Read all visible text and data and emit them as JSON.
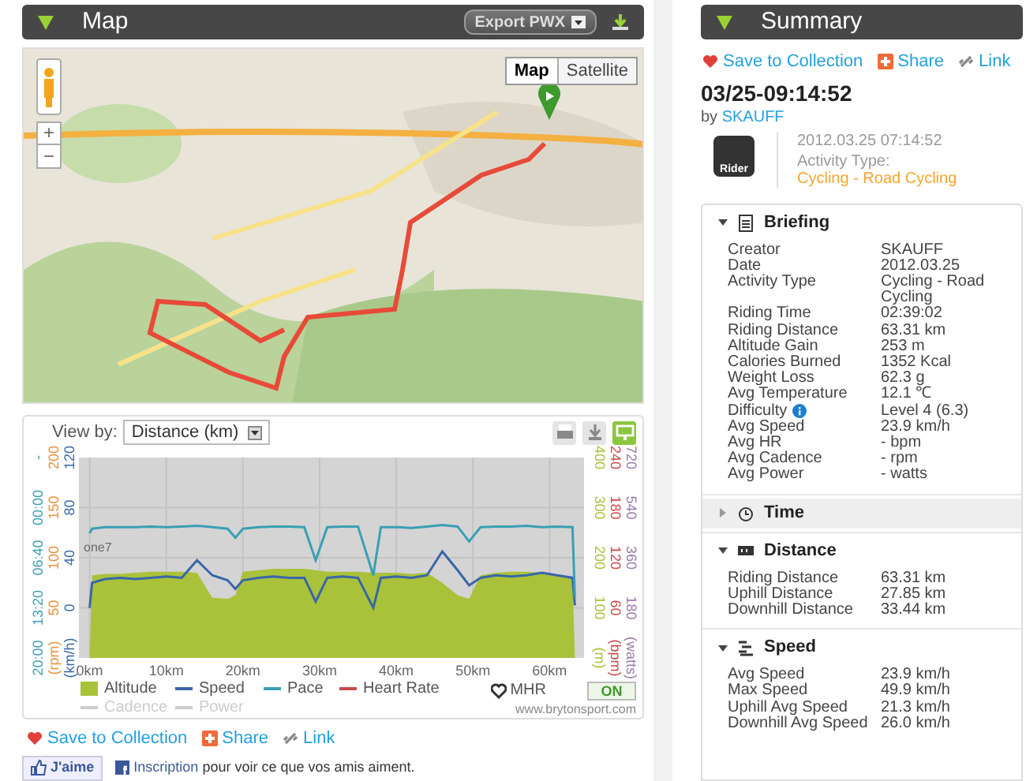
{
  "map_panel": {
    "title": "Map",
    "export_button": "Export PWX"
  },
  "map": {
    "kind": "picture",
    "map_types": [
      {
        "label": "Map",
        "selected": true
      },
      {
        "label": "Satellite",
        "selected": false
      }
    ],
    "zoom_in": "+",
    "zoom_out": "−"
  },
  "chart_panel": {
    "view_by_label": "View by:",
    "view_by_value": "Distance (km)",
    "tools": [
      {
        "kind": "print",
        "selected": false
      },
      {
        "kind": "download",
        "selected": false
      },
      {
        "kind": "screen",
        "selected": true
      }
    ],
    "left_axes": [
      {
        "color": "#e8913a",
        "ticks": [
          "(rpm)",
          "50",
          "100",
          "150",
          "200"
        ]
      }
    ],
    "right_axes": [
      {
        "color": "#c94a4a",
        "ticks": [
          "(bpm)",
          "60",
          "120",
          "180",
          "240"
        ]
      },
      {
        "color": "#9a7aa8",
        "ticks": [
          "(watts)",
          "180",
          "360",
          "540",
          "720"
        ]
      }
    ],
    "charts": [
      {
        "chart_data": {
          "type": "area",
          "x": [
            0,
            0.3,
            2,
            4,
            6,
            8,
            10,
            12,
            14,
            16,
            18,
            19,
            20,
            22,
            24,
            26,
            28,
            29.5,
            31,
            33,
            35,
            37,
            38,
            40,
            42,
            44,
            46,
            48,
            49.5,
            51,
            53,
            55,
            57,
            59,
            61,
            63,
            63.3
          ],
          "series": [
            {
              "name": "Altitude",
              "color": "#a9c23a",
              "values": [
                0,
                165,
                168,
                168,
                170,
                172,
                172,
                172,
                170,
                120,
                118,
                125,
                172,
                175,
                178,
                178,
                178,
                175,
                172,
                172,
                172,
                170,
                170,
                170,
                168,
                170,
                150,
                125,
                118,
                165,
                170,
                172,
                172,
                170,
                165,
                160,
                0
              ]
            }
          ],
          "xlim": [
            -1.4,
            64.5
          ],
          "ylim": [
            0,
            400
          ],
          "yticks": [
            {
              "value": 0,
              "label": "(m)"
            },
            100,
            200,
            300,
            400
          ]
        }
      },
      {
        "chart_data": {
          "type": "line",
          "x": [
            0,
            0.3,
            2,
            4,
            6,
            8,
            10,
            12,
            14,
            16,
            18,
            19,
            20,
            22,
            24,
            26,
            28,
            29.5,
            31,
            33,
            35,
            37,
            38,
            40,
            42,
            44,
            46,
            48,
            49.5,
            51,
            53,
            55,
            57,
            59,
            61,
            63,
            63.3
          ],
          "series": [
            {
              "name": "Speed",
              "color": "#3a66a8",
              "values": [
                0,
                20,
                23,
                24,
                23,
                24,
                25,
                24,
                38,
                26,
                22,
                15,
                22,
                24,
                25,
                24,
                24,
                5,
                24,
                25,
                24,
                0,
                24,
                25,
                24,
                26,
                45,
                30,
                18,
                24,
                26,
                25,
                26,
                28,
                26,
                24,
                2
              ]
            }
          ],
          "xlim": [
            -1.4,
            64.5
          ],
          "ylim": [
            -40,
            120
          ],
          "xticks": [
            {
              "value": 0,
              "label": "0km"
            },
            {
              "value": 10,
              "label": "10km"
            },
            {
              "value": 20,
              "label": "20km"
            },
            {
              "value": 30,
              "label": "30km"
            },
            {
              "value": 40,
              "label": "40km"
            },
            {
              "value": 50,
              "label": "50km"
            },
            {
              "value": 60,
              "label": "60km"
            }
          ],
          "yticks": [
            {
              "value": -40,
              "label": "(km/h)"
            },
            0,
            40,
            80,
            120
          ],
          "annotations": [
            "one7"
          ]
        }
      },
      {
        "chart_data": {
          "type": "line",
          "x": [
            0,
            0.3,
            2,
            4,
            6,
            8,
            10,
            12,
            14,
            16,
            18,
            19,
            20,
            22,
            24,
            26,
            28,
            29.5,
            31,
            33,
            35,
            37,
            38,
            40,
            42,
            44,
            46,
            48,
            49.5,
            51,
            53,
            55,
            57,
            59,
            61,
            63,
            63.3
          ],
          "series": [
            {
              "name": "Pace",
              "color": "#3a9fb5",
              "values": [
                3.4,
                2.8,
                2.6,
                2.6,
                2.6,
                2.5,
                2.6,
                2.5,
                2.4,
                2.6,
                2.8,
                4,
                2.8,
                2.6,
                2.5,
                2.5,
                2.6,
                7,
                2.6,
                2.5,
                2.5,
                9,
                2.6,
                2.6,
                2.7,
                2.5,
                2.3,
                2.5,
                4.5,
                2.6,
                2.5,
                2.5,
                2.4,
                2.6,
                2.5,
                2.6,
                12
              ]
            }
          ],
          "xlim": [
            -1.4,
            64.5
          ],
          "ylim": [
            20,
            -6.67
          ],
          "yticks": [
            {
              "value": 20,
              "label": "20:00"
            },
            {
              "value": 13.33,
              "label": "13:20"
            },
            {
              "value": 6.67,
              "label": "06:40"
            },
            {
              "value": 0,
              "label": "00:00"
            },
            {
              "value": -6.67,
              "label": "-"
            }
          ]
        }
      }
    ],
    "legend": [
      {
        "kind": "area",
        "enabled": true
      },
      {
        "kind": "line",
        "enabled": true
      },
      {
        "kind": "line",
        "enabled": true
      },
      {
        "label": "Heart Rate",
        "kind": "line",
        "color": "#c94a4a",
        "enabled": true
      },
      {
        "label": "Cadence",
        "kind": "line",
        "color": "#cccccc",
        "enabled": false
      },
      {
        "label": "Power",
        "kind": "line",
        "color": "#cccccc",
        "enabled": false
      }
    ],
    "mhr_label": "MHR",
    "mhr_toggle": {
      "label": "ON",
      "on": true
    },
    "credit": "www.brytonsport.com"
  },
  "actions": [
    {
      "kind": "save",
      "label": "Save to Collection"
    },
    {
      "kind": "share",
      "label": "Share"
    },
    {
      "kind": "link",
      "label": "Link"
    }
  ],
  "facebook": {
    "like_button": "J'aime",
    "signup_link": "Inscription",
    "signup_text": "pour voir ce que vos amis aiment."
  },
  "summary": {
    "title": "Summary",
    "actions": [
      {
        "kind": "save",
        "label": "Save to Collection"
      },
      {
        "kind": "share",
        "label": "Share"
      },
      {
        "kind": "link",
        "label": "Link"
      }
    ],
    "activity_title": "03/25-09:14:52",
    "by_label": "by",
    "author": "SKAUFF",
    "device_label": "Rider",
    "datetime": "2012.03.25 07:14:52",
    "activity_type_label": "Activity Type:",
    "activity_type": "Cycling - Road Cycling",
    "sections": [
      {
        "kind": "briefing",
        "title": "Briefing",
        "expanded": true,
        "rows": [
          {
            "label": "Creator",
            "value": "SKAUFF"
          },
          {
            "label": "Date",
            "value": "2012.03.25"
          },
          {
            "label": "Activity Type",
            "value": "Cycling - Road Cycling"
          },
          {
            "label": "Riding Time",
            "value": "02:39:02"
          },
          {
            "label": "Riding Distance",
            "value": "63.31 km"
          },
          {
            "label": "Altitude Gain",
            "value": "253 m"
          },
          {
            "label": "Calories Burned",
            "value": "1352 Kcal"
          },
          {
            "label": "Weight Loss",
            "value": "62.3 g"
          },
          {
            "label": "Avg Temperature",
            "value": "12.1 ℃"
          },
          {
            "label": "Difficulty",
            "value": "Level 4 (6.3)",
            "info": true
          },
          {
            "label": "Avg Speed",
            "value": "23.9 km/h"
          },
          {
            "label": "Avg HR",
            "value": "- bpm"
          },
          {
            "label": "Avg Cadence",
            "value": "- rpm"
          },
          {
            "label": "Avg Power",
            "value": "- watts"
          }
        ]
      },
      {
        "kind": "time",
        "title": "Time",
        "expanded": false
      },
      {
        "kind": "distance",
        "title": "Distance",
        "expanded": true,
        "rows": [
          {
            "label": "Riding Distance",
            "value": "63.31 km"
          },
          {
            "label": "Uphill Distance",
            "value": "27.85 km"
          },
          {
            "label": "Downhill Distance",
            "value": "33.44 km"
          }
        ]
      },
      {
        "kind": "speed",
        "title": "Speed",
        "expanded": true,
        "rows": [
          {
            "label": "Avg Speed",
            "value": "23.9 km/h"
          },
          {
            "label": "Max Speed",
            "value": "49.9 km/h"
          },
          {
            "label": "Uphill Avg Speed",
            "value": "21.3 km/h"
          },
          {
            "label": "Downhill Avg Speed",
            "value": "26.0 km/h"
          }
        ]
      }
    ]
  }
}
